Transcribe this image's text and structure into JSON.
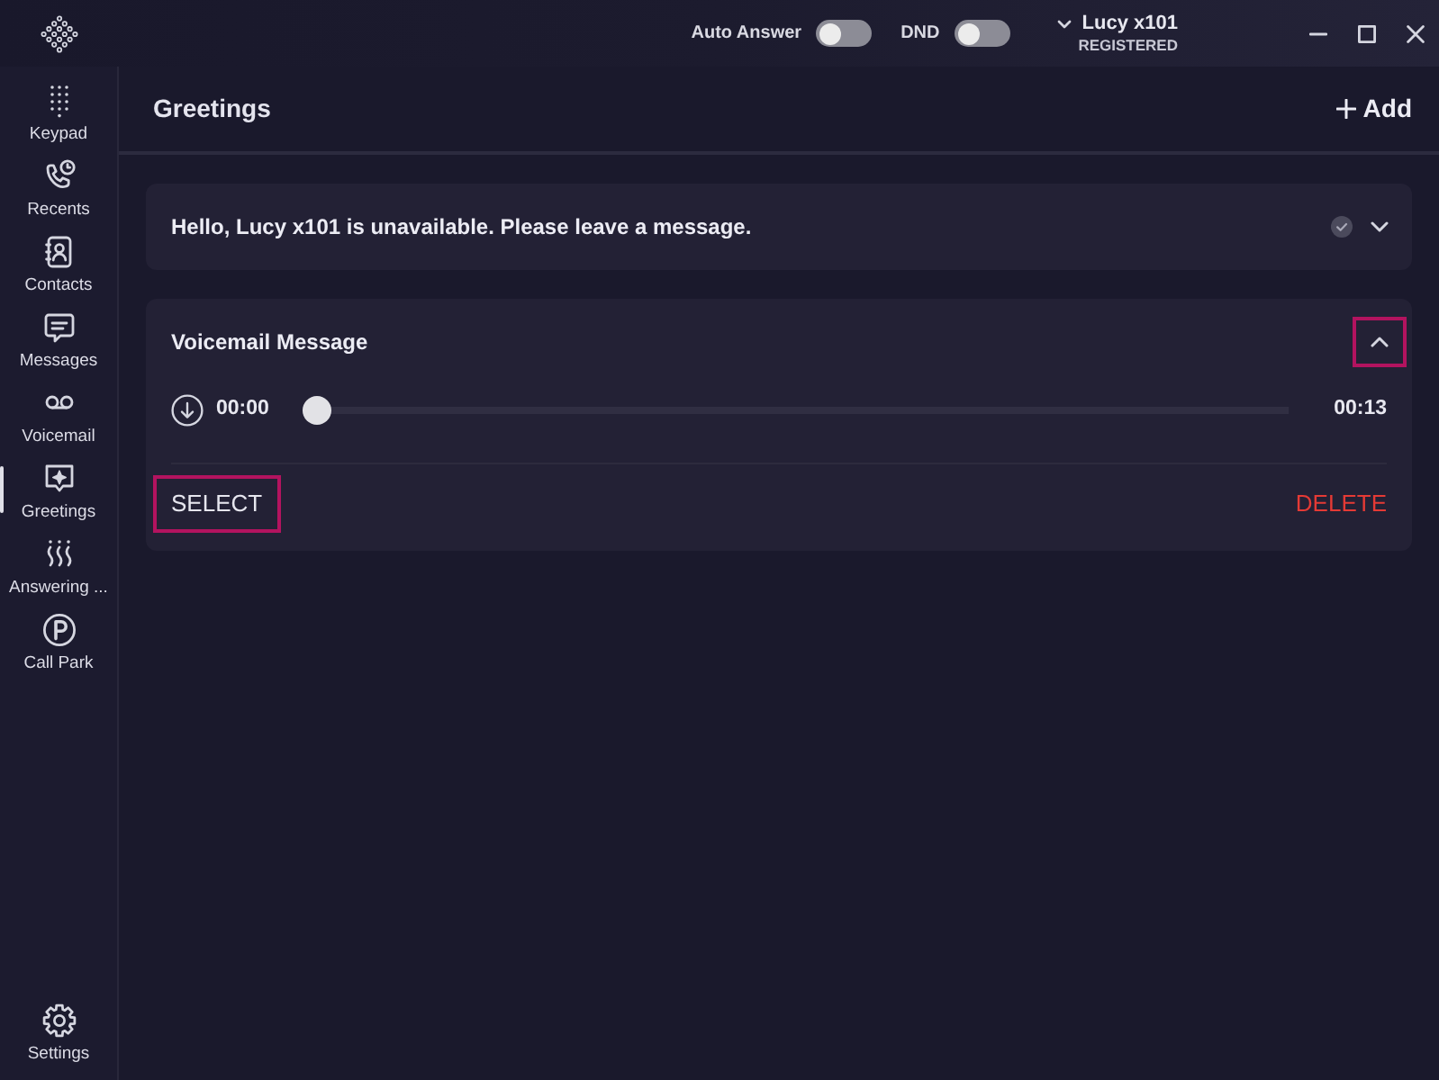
{
  "top_bar": {
    "toggles": [
      {
        "label": "Auto Answer",
        "on": false
      },
      {
        "label": "DND",
        "on": false
      }
    ],
    "account": {
      "name": "Lucy x101",
      "status": "REGISTERED"
    }
  },
  "sidebar": {
    "items": [
      {
        "label": "Keypad",
        "selected": false
      },
      {
        "label": "Recents",
        "selected": false
      },
      {
        "label": "Contacts",
        "selected": false
      },
      {
        "label": "Messages",
        "selected": false
      },
      {
        "label": "Voicemail",
        "selected": false
      },
      {
        "label": "Greetings",
        "selected": true
      },
      {
        "label": "Answering ...",
        "selected": false
      },
      {
        "label": "Call Park",
        "selected": false
      }
    ],
    "footer_items": [
      {
        "label": "Settings",
        "selected": false
      }
    ]
  },
  "page": {
    "title": "Greetings",
    "add_button": "Add"
  },
  "greetings": [
    {
      "title": "Hello, Lucy x101 is unavailable. Please leave a message.",
      "selected": true,
      "expanded": false,
      "toggle_highlighted": false
    },
    {
      "title": "Voicemail Message",
      "selected": false,
      "expanded": true,
      "toggle_highlighted": true,
      "player": {
        "elapsed": "00:00",
        "level": 0,
        "duration": "00:13"
      },
      "actions": [
        {
          "kind": "select",
          "label": "SELECT",
          "highlighted": true
        },
        {
          "kind": "delete",
          "label": "DELETE",
          "highlighted": false
        }
      ]
    }
  ]
}
